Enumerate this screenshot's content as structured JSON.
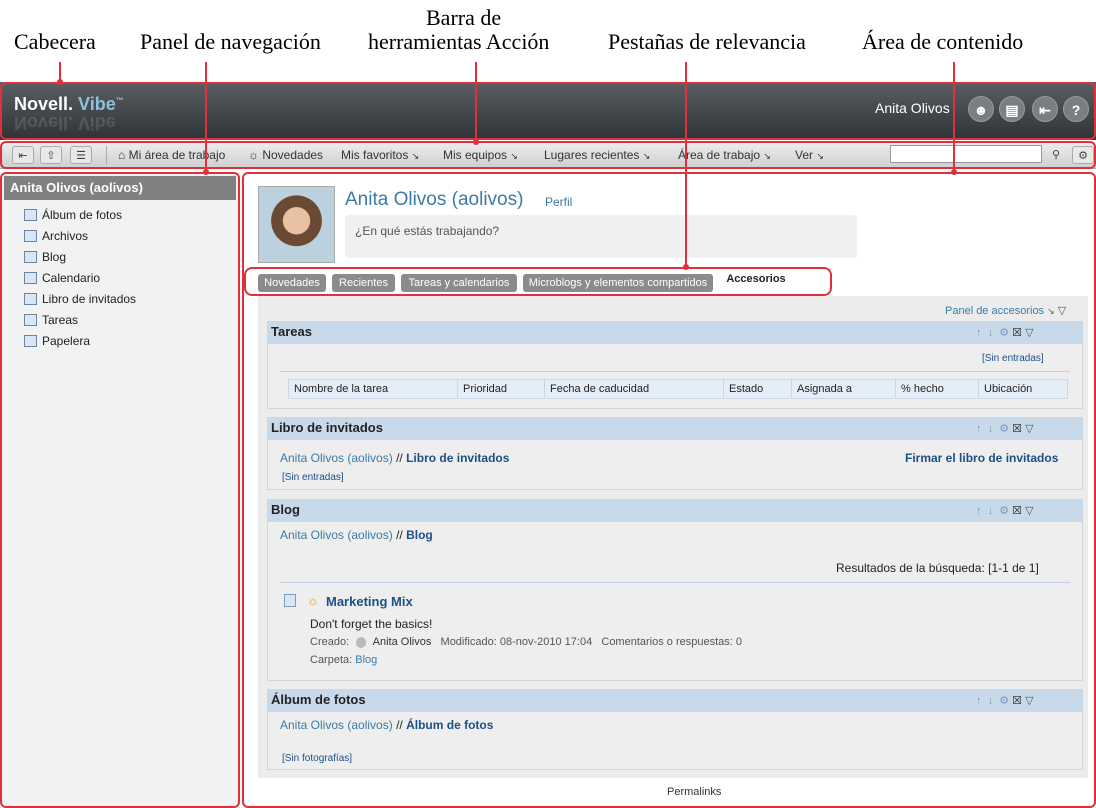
{
  "callouts": {
    "header": "Cabecera",
    "nav": "Panel de navegación",
    "toolbar_line1": "Barra de",
    "toolbar_line2": "herramientas Acción",
    "tabs": "Pestañas de relevancia",
    "content": "Área de contenido"
  },
  "header": {
    "logo_brand": "Novell.",
    "logo_product": "Vibe",
    "user_name": "Anita Olivos",
    "icons": [
      "user-settings-icon",
      "clipboard-icon",
      "logout-icon",
      "help-icon"
    ],
    "help_glyph": "?"
  },
  "toolbar": {
    "items": [
      "Mi área de trabajo",
      "Novedades",
      "Mis favoritos",
      "Mis equipos",
      "Lugares recientes",
      "Área de trabajo",
      "Ver"
    ],
    "search_placeholder": ""
  },
  "nav": {
    "title": "Anita Olivos (aolivos)",
    "items": [
      "Álbum de fotos",
      "Archivos",
      "Blog",
      "Calendario",
      "Libro de invitados",
      "Tareas",
      "Papelera"
    ]
  },
  "profile": {
    "name": "Anita Olivos (aolivos)",
    "profile_link": "Perfil",
    "status_placeholder": "¿En qué estás trabajando?"
  },
  "tabs": [
    "Novedades",
    "Recientes",
    "Tareas y calendarios",
    "Microblogs y elementos compartidos",
    "Accesorios"
  ],
  "accessories": {
    "panel_link": "Panel de accesorios",
    "tasks": {
      "title": "Tareas",
      "no_entries": "[Sin entradas]",
      "columns": [
        "Nombre de la tarea",
        "Prioridad",
        "Fecha de caducidad",
        "Estado",
        "Asignada a",
        "% hecho",
        "Ubicación"
      ]
    },
    "guestbook": {
      "title": "Libro de invitados",
      "crumb_user": "Anita Olivos (aolivos)",
      "crumb_sep": "//",
      "crumb_target": "Libro de invitados",
      "sign_link": "Firmar el libro de invitados",
      "no_entries": "[Sin entradas]"
    },
    "blog": {
      "title": "Blog",
      "crumb_user": "Anita Olivos (aolivos)",
      "crumb_sep": "//",
      "crumb_target": "Blog",
      "results": "Resultados de la búsqueda: [1-1 de 1]",
      "entry_title": "Marketing Mix",
      "entry_text": "Don't forget the basics!",
      "created_label": "Creado:",
      "created_by": "Anita Olivos",
      "modified": "Modificado: 08-nov-2010 17:04",
      "comments": "Comentarios o respuestas: 0",
      "folder_label": "Carpeta:",
      "folder_link": "Blog"
    },
    "album": {
      "title": "Álbum de fotos",
      "crumb_user": "Anita Olivos (aolivos)",
      "crumb_sep": "//",
      "crumb_target": "Álbum de fotos",
      "no_photos": "[Sin fotografías]"
    }
  },
  "footer": {
    "permalinks": "Permalinks"
  },
  "colors": {
    "callout": "#e0303c",
    "header_bg": "#3e4347",
    "link": "#3a7ba8",
    "panel_header": "#c8d9ea"
  }
}
